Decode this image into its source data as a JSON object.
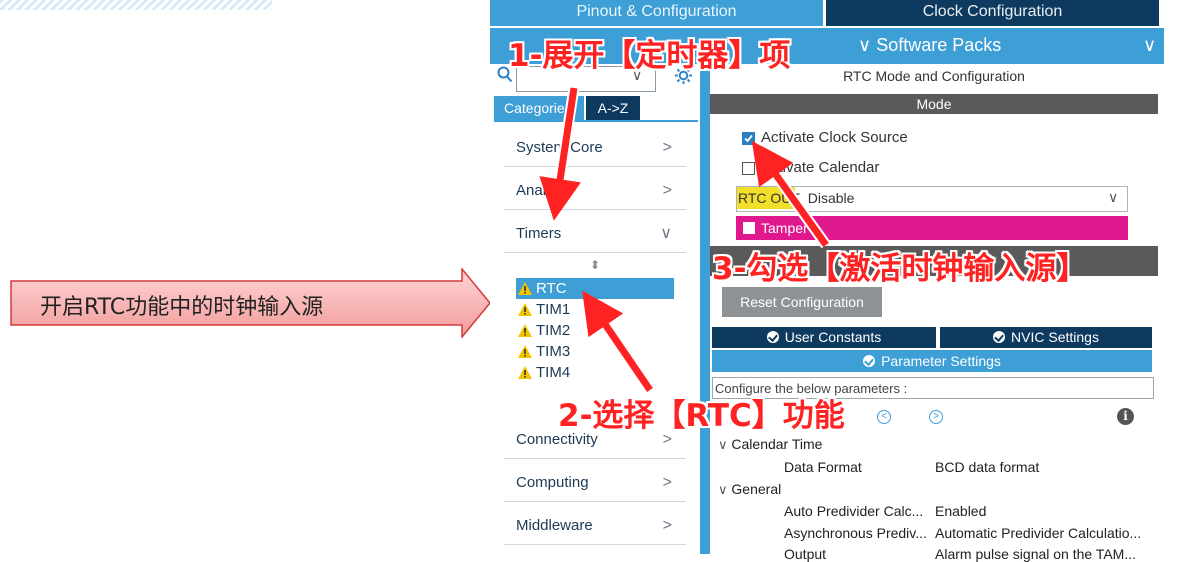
{
  "tabs": {
    "pinout": "Pinout & Configuration",
    "clock": "Clock Configuration",
    "software_packs": "Software Packs"
  },
  "sidebar": {
    "search_placeholder": "",
    "tab_categories": "Categories",
    "tab_az": "A->Z",
    "categories": [
      {
        "label": "System Core"
      },
      {
        "label": "Analog"
      },
      {
        "label": "Timers"
      },
      {
        "label": "Connectivity"
      },
      {
        "label": "Computing"
      },
      {
        "label": "Middleware"
      }
    ],
    "timers": [
      {
        "label": "RTC",
        "selected": true
      },
      {
        "label": "TIM1",
        "selected": false
      },
      {
        "label": "TIM2",
        "selected": false
      },
      {
        "label": "TIM3",
        "selected": false
      },
      {
        "label": "TIM4",
        "selected": false
      }
    ]
  },
  "rtc_panel": {
    "title": "RTC Mode and Configuration",
    "mode_header": "Mode",
    "activate_clock_source": {
      "label": "Activate Clock Source",
      "checked": true
    },
    "activate_calendar": {
      "label": "Activate Calendar",
      "checked": false
    },
    "rtc_out": {
      "label": "RTC OUT",
      "value": "Disable"
    },
    "tamper": {
      "label": "Tamper"
    },
    "reset_button": "Reset Configuration",
    "tab_user_constants": "User Constants",
    "tab_nvic": "NVIC Settings",
    "tab_parameter": "Parameter Settings",
    "configure_hint": "Configure the below parameters :",
    "groups": {
      "calendar_time": "Calendar Time",
      "general": "General"
    },
    "params": [
      {
        "name": "Data Format",
        "value": "BCD data format"
      },
      {
        "name": "Auto Predivider Calc...",
        "value": "Enabled"
      },
      {
        "name": "Asynchronous Prediv...",
        "value": "Automatic Predivider Calculatio..."
      },
      {
        "name": "Output",
        "value": "Alarm pulse signal on the TAM..."
      }
    ]
  },
  "annotations": {
    "callout": "开启RTC功能中的时钟输入源",
    "step1": "1-展开【定时器】项",
    "step2": "2-选择【RTC】功能",
    "step3": "3-勾选【激活时钟输入源】"
  },
  "colors": {
    "accent": "#3d9fd6",
    "dark_tab": "#0f3a5f",
    "annotation": "#ff2222",
    "tamper": "#e0188d"
  }
}
